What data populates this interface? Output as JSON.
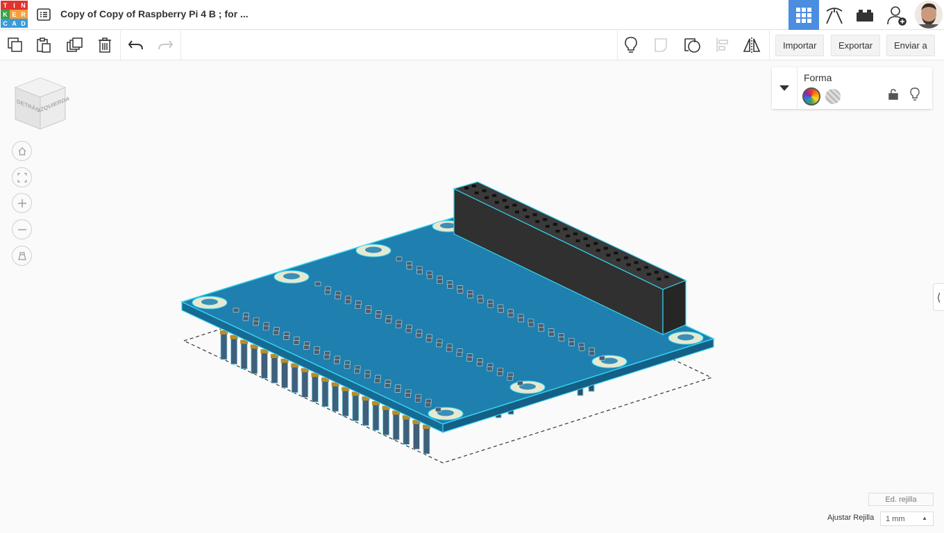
{
  "app": {
    "logo_letters": [
      "T",
      "I",
      "N",
      "K",
      "E",
      "R",
      "C",
      "A",
      "D"
    ],
    "logo_colors": [
      "#e2332f",
      "#e2332f",
      "#e2332f",
      "#f2a03d",
      "#f2a03d",
      "#f2a03d",
      "#3a9bd9",
      "#3a9bd9",
      "#3a9bd9"
    ],
    "document_title": "Copy of Copy of Raspberry Pi 4 B ; for ..."
  },
  "header_icons": [
    "3d-design-grid-icon",
    "codeblocks-pickaxe-icon",
    "bricks-icon",
    "invite-user-icon"
  ],
  "toolbar": {
    "import_label": "Importar",
    "export_label": "Exportar",
    "send_label": "Enviar a"
  },
  "viewcube": {
    "back_label": "DETRÁS",
    "left_label": "IZQUIERDA"
  },
  "shape_panel": {
    "title": "Forma"
  },
  "grid": {
    "edit_label": "Ed. rejilla",
    "snap_label": "Ajustar Rejilla",
    "snap_value": "1 mm"
  },
  "colors": {
    "accent": "#4b8de0",
    "board": "#1f7fae",
    "board_side": "#176a94",
    "selection_outline": "#34d4f0",
    "header_block": "#2d2d2d"
  }
}
